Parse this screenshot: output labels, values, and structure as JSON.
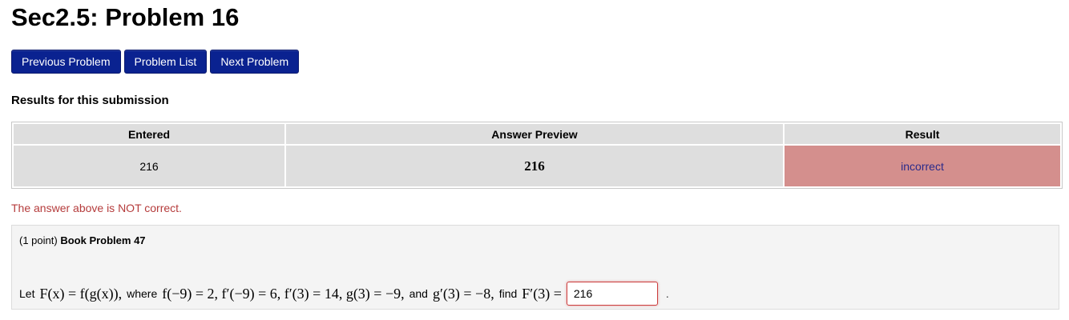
{
  "page": {
    "title": "Sec2.5: Problem 16"
  },
  "nav": {
    "previous_label": "Previous Problem",
    "list_label": "Problem List",
    "next_label": "Next Problem"
  },
  "results": {
    "heading": "Results for this submission",
    "columns": [
      "Entered",
      "Answer Preview",
      "Result"
    ],
    "row": {
      "entered": "216",
      "preview": "216",
      "result": "incorrect"
    },
    "feedback": "The answer above is NOT correct."
  },
  "problem": {
    "points": "(1 point)",
    "book": "Book Problem 47",
    "let_text": "Let",
    "F_def": "F(x) = f(g(x)),",
    "where_text": "where",
    "conditions": "f(−9) = 2,  f′(−9) = 6,  f′(3) = 14,  g(3) = −9,",
    "and_text": "and",
    "gprime": "g′(3) = −8,",
    "find_text": "find",
    "target": "F′(3) =",
    "answer_value": "216",
    "trailing": "."
  },
  "colors": {
    "button_bg": "#0a2290",
    "incorrect_bg": "#d48f8d",
    "feedback_text": "#b53c3c",
    "input_border": "#cc3d3d"
  }
}
